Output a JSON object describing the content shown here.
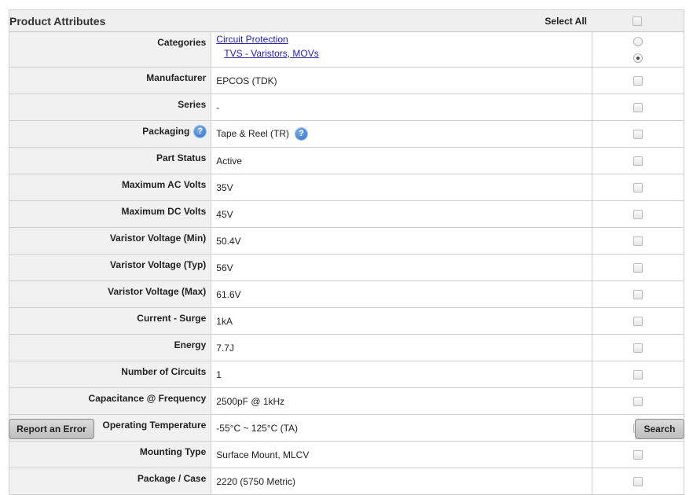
{
  "header": {
    "title": "Product Attributes",
    "select_all_label": "Select All"
  },
  "categories": {
    "label": "Categories",
    "links": [
      "Circuit Protection",
      "TVS - Varistors, MOVs"
    ],
    "selected_index": 1
  },
  "rows": [
    {
      "label": "Manufacturer",
      "value": "EPCOS (TDK)"
    },
    {
      "label": "Series",
      "value": "-"
    },
    {
      "label": "Packaging",
      "value": "Tape & Reel (TR)"
    },
    {
      "label": "Part Status",
      "value": "Active"
    },
    {
      "label": "Maximum AC Volts",
      "value": "35V"
    },
    {
      "label": "Maximum DC Volts",
      "value": "45V"
    },
    {
      "label": "Varistor Voltage (Min)",
      "value": "50.4V"
    },
    {
      "label": "Varistor Voltage (Typ)",
      "value": "56V"
    },
    {
      "label": "Varistor Voltage (Max)",
      "value": "61.6V"
    },
    {
      "label": "Current - Surge",
      "value": "1kA"
    },
    {
      "label": "Energy",
      "value": "7.7J"
    },
    {
      "label": "Number of Circuits",
      "value": "1"
    },
    {
      "label": "Capacitance @ Frequency",
      "value": "2500pF @ 1kHz"
    },
    {
      "label": "Operating Temperature",
      "value": "-55°C ~ 125°C (TA)"
    },
    {
      "label": "Mounting Type",
      "value": "Surface Mount, MLCV"
    },
    {
      "label": "Package / Case",
      "value": "2220 (5750 Metric)"
    }
  ],
  "help_icon": {
    "glyph": "?"
  },
  "buttons": {
    "report": "Report an Error",
    "search": "Search"
  }
}
